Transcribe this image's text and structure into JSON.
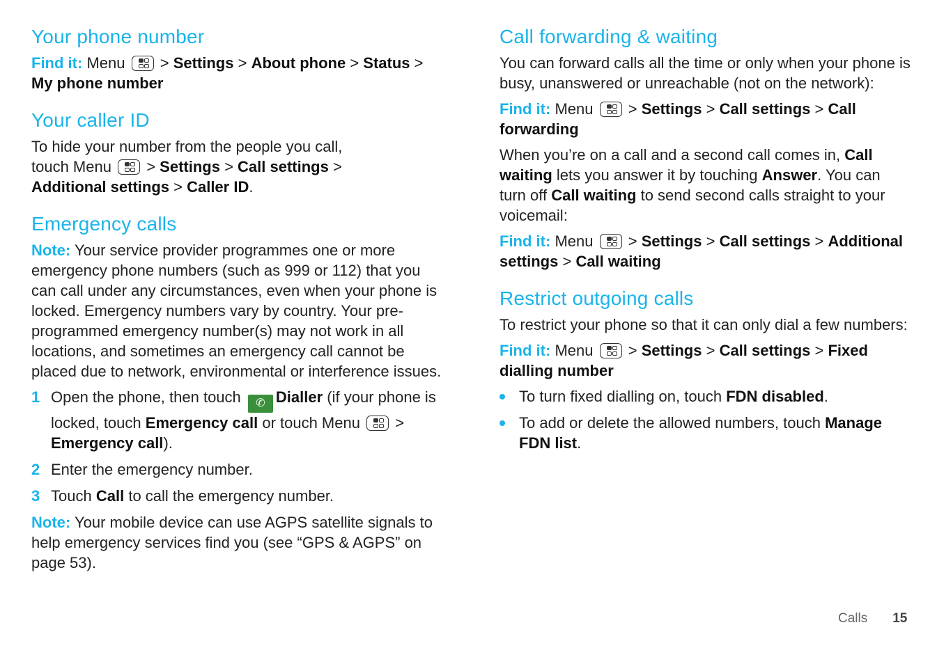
{
  "left": {
    "phone_number": {
      "title": "Your phone number",
      "findit": "Find it:",
      "menu": "Menu",
      "path": [
        "Settings",
        "About phone",
        "Status",
        "My phone number"
      ]
    },
    "caller_id": {
      "title": "Your caller ID",
      "text1": "To hide your number from the people you call,",
      "text2": "touch Menu",
      "path": [
        "Settings",
        "Call settings",
        "Additional settings",
        "Caller ID"
      ]
    },
    "emergency": {
      "title": "Emergency calls",
      "note_label": "Note:",
      "note_text": "Your service provider programmes one or more emergency phone numbers (such as 999 or 112) that you can call under any circumstances, even when your phone is locked. Emergency numbers vary by country. Your pre-programmed emergency number(s) may not work in all locations, and sometimes an emergency call cannot be placed due to network, environmental or interference issues.",
      "steps": [
        {
          "num": "1",
          "pre": "Open the phone, then touch",
          "dialler": "Dialler",
          "mid": "(if your phone is locked, touch",
          "emergency_call": "Emergency call",
          "or": "or touch Menu",
          "end_bold": "Emergency call",
          "end": ")."
        },
        {
          "num": "2",
          "text": "Enter the emergency number."
        },
        {
          "num": "3",
          "pre": "Touch",
          "bold": "Call",
          "post": "to call the emergency number."
        }
      ],
      "note2_label": "Note:",
      "note2_text": "Your mobile device can use AGPS satellite signals to help emergency services find you (see “GPS & AGPS” on page 53)."
    }
  },
  "right": {
    "forwarding": {
      "title": "Call forwarding & waiting",
      "intro": "You can forward calls all the time or only when your phone is busy, unanswered or unreachable (not on the network):",
      "findit": "Find it:",
      "menu": "Menu",
      "path1": [
        "Settings",
        "Call settings",
        "Call forwarding"
      ],
      "waiting_pre": "When you’re on a call and a second call comes in,",
      "waiting_bold": "Call waiting",
      "waiting_mid": "lets you answer it by touching",
      "answer": "Answer",
      "waiting_mid2": ". You can turn off",
      "waiting_bold2": "Call waiting",
      "waiting_end": "to send second calls straight to your voicemail:",
      "path2": [
        "Settings",
        "Call settings",
        "Additional settings",
        "Call waiting"
      ]
    },
    "restrict": {
      "title": "Restrict outgoing calls",
      "intro": "To restrict your phone so that it can only dial a few numbers:",
      "findit": "Find it:",
      "menu": "Menu",
      "path": [
        "Settings",
        "Call settings",
        "Fixed dialling number"
      ],
      "bullets": [
        {
          "pre": "To turn fixed dialling on, touch",
          "bold": "FDN disabled",
          "post": "."
        },
        {
          "pre": "To add or delete the allowed numbers, touch",
          "bold": "Manage FDN list",
          "post": "."
        }
      ]
    }
  },
  "footer": {
    "section": "Calls",
    "page": "15"
  }
}
